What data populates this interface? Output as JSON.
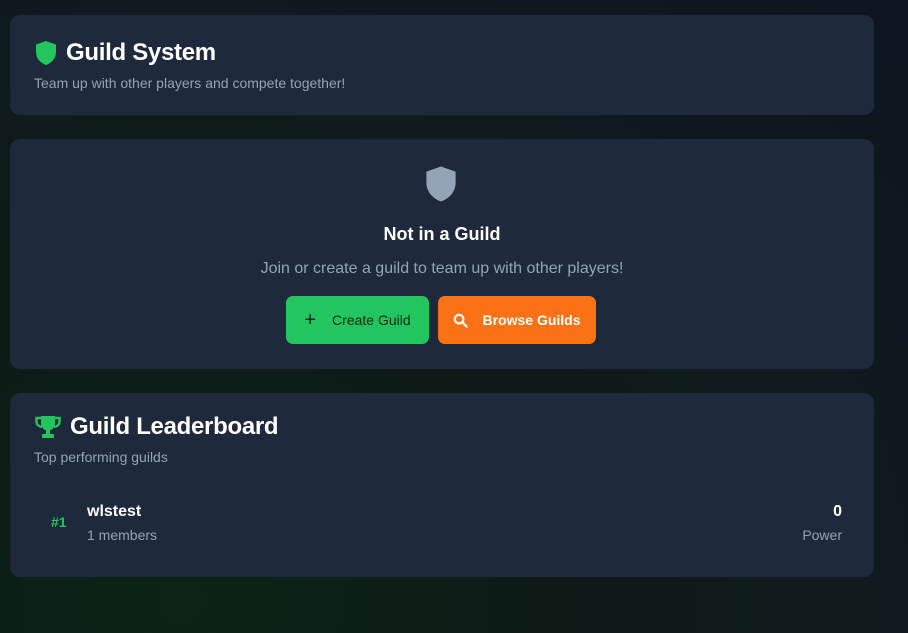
{
  "header": {
    "icon": "shield-icon",
    "title": "Guild System",
    "subtitle": "Team up with other players and compete together!"
  },
  "empty_state": {
    "icon": "shield-icon",
    "title": "Not in a Guild",
    "description": "Join or create a guild to team up with other players!",
    "create_button": {
      "icon": "plus-icon",
      "label": "Create Guild"
    },
    "browse_button": {
      "icon": "search-icon",
      "label": "Browse Guilds"
    }
  },
  "leaderboard": {
    "icon": "trophy-icon",
    "title": "Guild Leaderboard",
    "subtitle": "Top performing guilds",
    "entries": [
      {
        "rank": "#1",
        "name": "wlstest",
        "members": "1 members",
        "power": "0",
        "power_label": "Power"
      }
    ]
  },
  "colors": {
    "card": "#1e293b",
    "accent_green": "#22c55e",
    "accent_orange": "#f97316",
    "muted_text": "#94a3b8",
    "muted_icon": "#94a3b8"
  }
}
